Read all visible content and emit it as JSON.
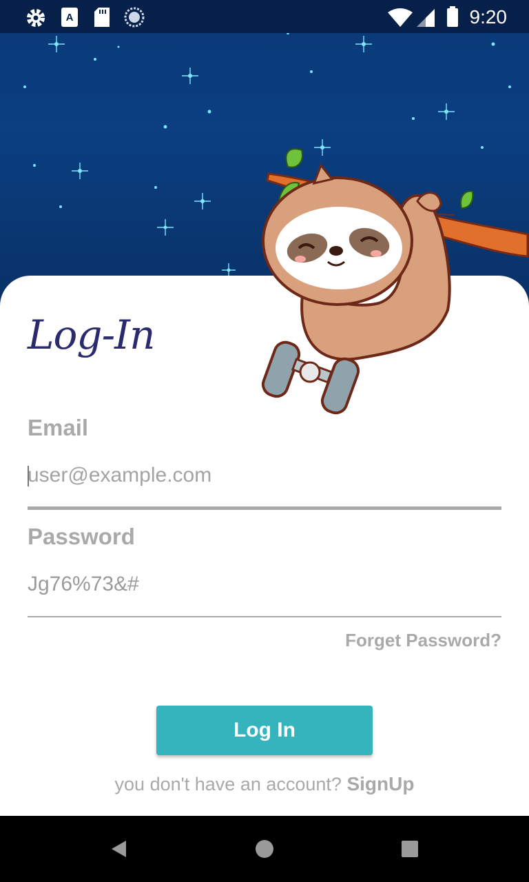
{
  "status_bar": {
    "time": "9:20",
    "icons": [
      "gear-icon",
      "keyboard-icon",
      "sd-card-icon",
      "sync-icon",
      "wifi-icon",
      "signal-icon",
      "battery-icon"
    ]
  },
  "login": {
    "title": "Log-In",
    "email_label": "Email",
    "email_placeholder": "user@example.com",
    "password_label": "Password",
    "password_value": "Jg76%73&#",
    "forgot_password": "Forget Password?",
    "login_button": "Log In",
    "signup_prompt": "you don't have an account?",
    "signup_link": "SignUp"
  },
  "colors": {
    "header_bg": "#0a3a78",
    "accent": "#35b4bd",
    "title": "#2a2a6e",
    "muted_text": "#a9a9a9"
  },
  "nav_bar": {
    "icons": [
      "back-icon",
      "home-icon",
      "recents-icon"
    ]
  }
}
